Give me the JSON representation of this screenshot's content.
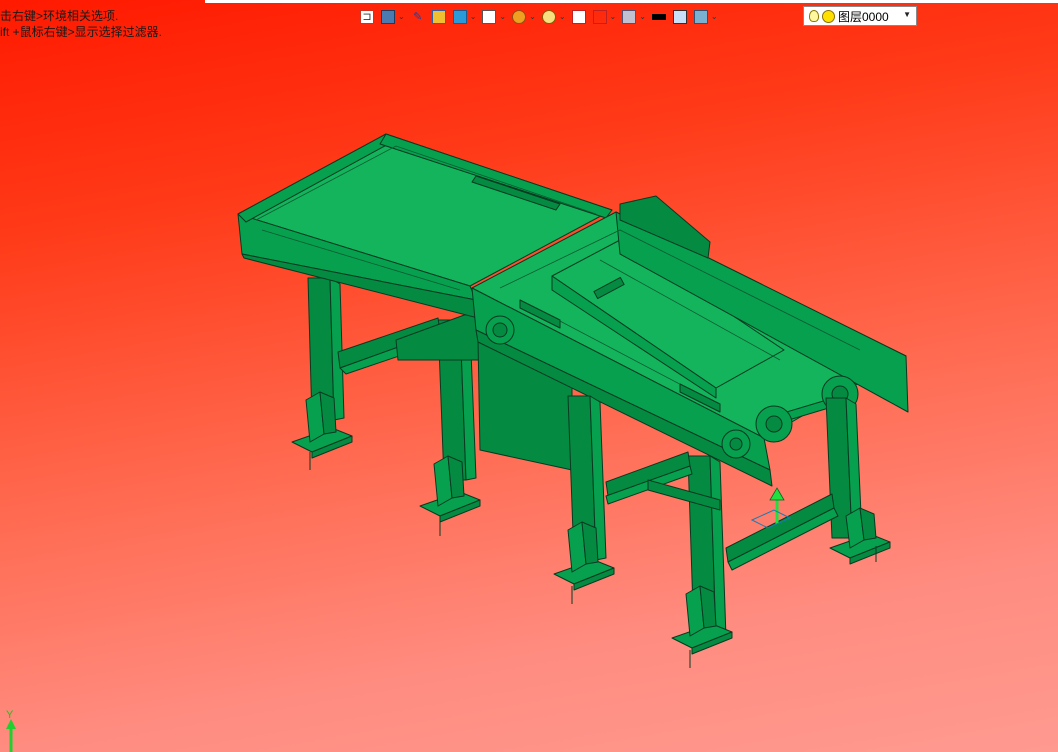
{
  "hints": {
    "line1": "击右键>环境相关选项.",
    "line2": "ift +鼠标右键>显示选择过滤器."
  },
  "toolbar": {
    "buttons": [
      {
        "name": "exit-sketch-icon",
        "dropdown": false
      },
      {
        "name": "view-orientation-icon",
        "dropdown": true
      },
      {
        "name": "pencil-icon",
        "dropdown": false
      },
      {
        "name": "shaded-box-icon",
        "dropdown": false
      },
      {
        "name": "display-style-icon",
        "dropdown": true
      },
      {
        "name": "view-cube-icon",
        "dropdown": true
      },
      {
        "name": "render-sphere-icon",
        "dropdown": true
      },
      {
        "name": "zoom-icon",
        "dropdown": true
      },
      {
        "name": "section-view-icon",
        "dropdown": false
      },
      {
        "name": "dimension-icon",
        "dropdown": true
      },
      {
        "name": "hierarchy-icon",
        "dropdown": true
      },
      {
        "name": "line-color-icon",
        "dropdown": false
      },
      {
        "name": "fill-color-icon",
        "dropdown": false
      },
      {
        "name": "layers-icon",
        "dropdown": true
      }
    ]
  },
  "layer": {
    "value": "图层0000",
    "bulb_icon": "lightbulb-icon",
    "state_icon": "layer-on-icon"
  },
  "triad": {
    "y_label": "Y"
  },
  "colors": {
    "background_top": "#ff1a00",
    "background_bottom": "#ff9a90",
    "model_green": "#06a04e",
    "model_edge": "#063a20",
    "handle_green": "#20e040"
  }
}
